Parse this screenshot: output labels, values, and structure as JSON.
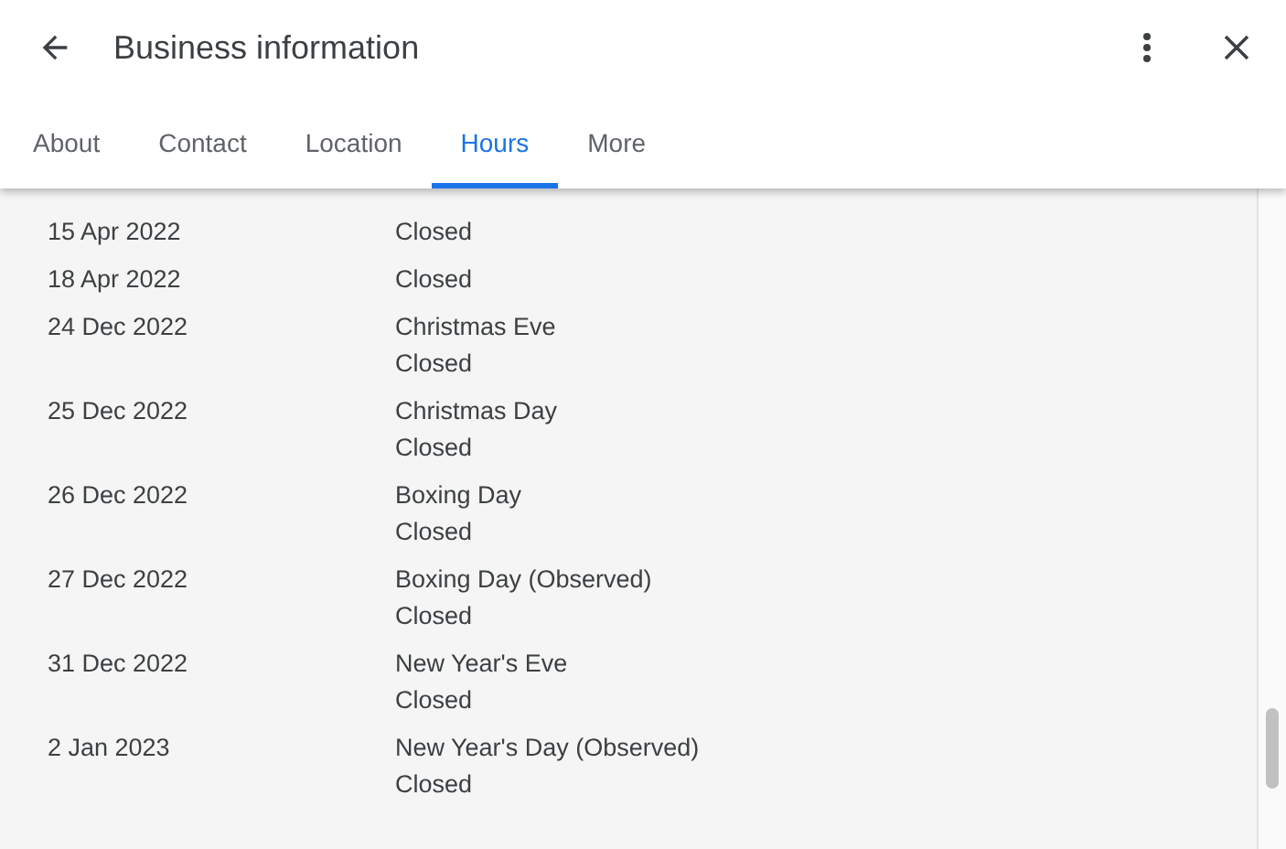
{
  "header": {
    "title": "Business information"
  },
  "tabs": [
    {
      "label": "About",
      "selected": false
    },
    {
      "label": "Contact",
      "selected": false
    },
    {
      "label": "Location",
      "selected": false
    },
    {
      "label": "Hours",
      "selected": true
    },
    {
      "label": "More",
      "selected": false
    }
  ],
  "hours": [
    {
      "date": "15 Apr 2022",
      "lines": [
        "Closed"
      ]
    },
    {
      "date": "18 Apr 2022",
      "lines": [
        "Closed"
      ]
    },
    {
      "date": "24 Dec 2022",
      "lines": [
        "Christmas Eve",
        "Closed"
      ]
    },
    {
      "date": "25 Dec 2022",
      "lines": [
        "Christmas Day",
        "Closed"
      ]
    },
    {
      "date": "26 Dec 2022",
      "lines": [
        "Boxing Day",
        "Closed"
      ]
    },
    {
      "date": "27 Dec 2022",
      "lines": [
        "Boxing Day (Observed)",
        "Closed"
      ]
    },
    {
      "date": "31 Dec 2022",
      "lines": [
        "New Year's Eve",
        "Closed"
      ]
    },
    {
      "date": "2 Jan 2023",
      "lines": [
        "New Year's Day (Observed)",
        "Closed"
      ]
    }
  ]
}
